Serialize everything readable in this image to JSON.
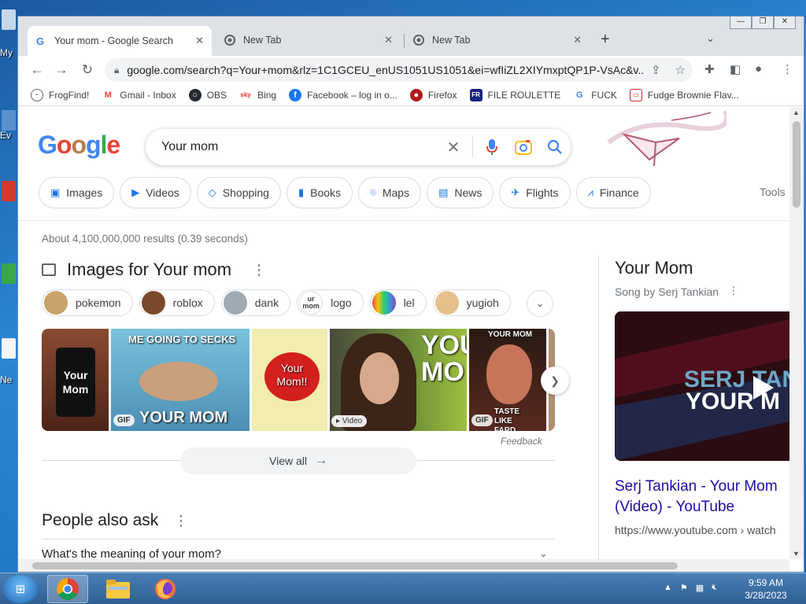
{
  "desktop": {
    "labels": [
      "My",
      "Ev",
      "Ne"
    ]
  },
  "browser": {
    "tabs": [
      {
        "title": "Your mom - Google Search",
        "favicon": "google-icon",
        "active": true
      },
      {
        "title": "New Tab",
        "favicon": "chrome-icon",
        "active": false
      },
      {
        "title": "New Tab",
        "favicon": "chrome-icon",
        "active": false
      }
    ],
    "new_tab_symbol": "+",
    "window_controls": {
      "minimize": "—",
      "maximize": "❐",
      "close": "✕"
    },
    "url": "google.com/search?q=Your+mom&rlz=1C1GCEU_enUS1051US1051&ei=wfIiZL2XIYmxptQP1P-VsAc&v..."
  },
  "bookmarks": [
    {
      "label": "FrogFind!",
      "icon": "globe-icon",
      "color": "#5f6368"
    },
    {
      "label": "Gmail - Inbox",
      "icon": "gmail-icon",
      "color": "#ea4335"
    },
    {
      "label": "OBS",
      "icon": "github-icon",
      "color": "#24292e"
    },
    {
      "label": "Bing",
      "icon": "bing-icon",
      "color": "#e5322d"
    },
    {
      "label": "Facebook – log in o...",
      "icon": "facebook-icon",
      "color": "#1877f2"
    },
    {
      "label": "Firefox",
      "icon": "firefox-icon",
      "color": "#b31b1b"
    },
    {
      "label": "FILE ROULETTE",
      "icon": "file-roulette-icon",
      "color": "#1a237e"
    },
    {
      "label": "FUCK",
      "icon": "google-icon",
      "color": "#4285f4"
    },
    {
      "label": "Fudge Brownie Flav...",
      "icon": "store-icon",
      "color": "#c62828"
    }
  ],
  "search": {
    "query": "Your mom",
    "logo_letters": [
      "G",
      "o",
      "o",
      "g",
      "l",
      "e"
    ]
  },
  "nav_chips": [
    {
      "label": "Images",
      "icon": "image-icon"
    },
    {
      "label": "Videos",
      "icon": "play-icon"
    },
    {
      "label": "Shopping",
      "icon": "tag-icon"
    },
    {
      "label": "Books",
      "icon": "book-icon"
    },
    {
      "label": "Maps",
      "icon": "map-pin-icon"
    },
    {
      "label": "News",
      "icon": "news-icon"
    },
    {
      "label": "Flights",
      "icon": "plane-icon"
    },
    {
      "label": "Finance",
      "icon": "chart-icon"
    }
  ],
  "tools_label": "Tools",
  "result_stats": "About 4,100,000,000 results (0.39 seconds)",
  "images_section": {
    "title": "Images for Your mom",
    "filter_chips": [
      {
        "label": "pokemon",
        "color": "#c9a36b"
      },
      {
        "label": "roblox",
        "color": "#7a4a2a"
      },
      {
        "label": "dank",
        "color": "#a0aab3"
      },
      {
        "label": "logo",
        "color": "#ffffff",
        "thumb_text": "ur mom"
      },
      {
        "label": "lel",
        "color": "#8e44ad"
      },
      {
        "label": "yugioh",
        "color": "#e6c08a"
      }
    ],
    "tiles": [
      {
        "caption": "Your Mom",
        "badge": "",
        "bg": "#6b3a2a"
      },
      {
        "caption": "ME GOING TO SECKS",
        "caption2": "YOUR MOM",
        "badge": "GIF",
        "bg": "#5aa7c7"
      },
      {
        "caption": "Your Mom!!",
        "badge": "",
        "bg": "#f3ecb0"
      },
      {
        "caption": "YOU MO",
        "badge": "Video",
        "bg": "#7cae3a"
      },
      {
        "caption": "YOUR MOM",
        "caption2": "TASTE LIKE FARD",
        "badge": "GIF",
        "bg": "#2a1a14"
      }
    ],
    "feedback": "Feedback",
    "view_all": "View all"
  },
  "people_also_ask": {
    "title": "People also ask",
    "questions": [
      "What's the meaning of your mom?"
    ]
  },
  "knowledge_panel": {
    "title": "Your Mom",
    "subtitle": "Song by Serj Tankian",
    "video_text_1": "SERJ TANKI",
    "video_text_2": "YOUR M",
    "link_title": "Serj Tankian - Your Mom (Video) - YouTube",
    "link_url": "https://www.youtube.com › watch"
  },
  "taskbar": {
    "apps": [
      "chrome",
      "explorer",
      "firefox"
    ],
    "time": "9:59 AM",
    "date": "3/28/2023"
  }
}
